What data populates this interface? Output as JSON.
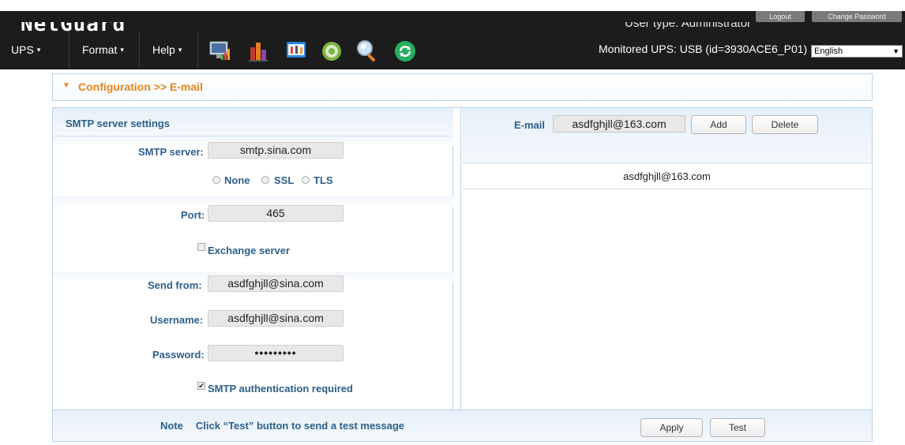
{
  "app": {
    "logo": "NetGuard",
    "user_type": "User type: Administrator",
    "logout_label": "Logout",
    "change_password_label": "Change Password"
  },
  "menu": {
    "ups": "UPS",
    "format": "Format",
    "help": "Help",
    "caret": "▾"
  },
  "toolbar_icons": [
    "monitor-chart-icon",
    "bar-chart-icon",
    "config-tools-icon",
    "settings-gear-icon",
    "search-magnifier-icon",
    "refresh-icon"
  ],
  "monitored_ups": "Monitored UPS: USB (id=3930ACE6_P01)",
  "language": {
    "selected": "English"
  },
  "breadcrumb": "Configuration >> E-mail",
  "smtp": {
    "section_title": "SMTP server settings",
    "server_label": "SMTP server:",
    "server_value": "smtp.sina.com",
    "encryption_options": [
      "None",
      "SSL",
      "TLS"
    ],
    "port_label": "Port:",
    "port_value": "465",
    "exchange_label": "Exchange server",
    "exchange_checked": false,
    "send_from_label": "Send from:",
    "send_from_value": "asdfghjll@sina.com",
    "username_label": "Username:",
    "username_value": "asdfghjll@sina.com",
    "password_label": "Password:",
    "password_value": "•••••••••",
    "auth_label": "SMTP authentication required",
    "auth_checked": true
  },
  "email": {
    "label": "E-mail",
    "input_value": "asdfghjll@163.com",
    "add_label": "Add",
    "delete_label": "Delete",
    "list": [
      "asdfghjll@163.com"
    ]
  },
  "footer": {
    "note_label": "Note",
    "note_text": "Click “Test” button to send a test message",
    "apply_label": "Apply",
    "test_label": "Test"
  },
  "colors": {
    "topbar": "#1c1c1c",
    "accent_orange": "#e8851c",
    "label_blue": "#2c5f8a",
    "border_blue": "#b9d4ea"
  }
}
